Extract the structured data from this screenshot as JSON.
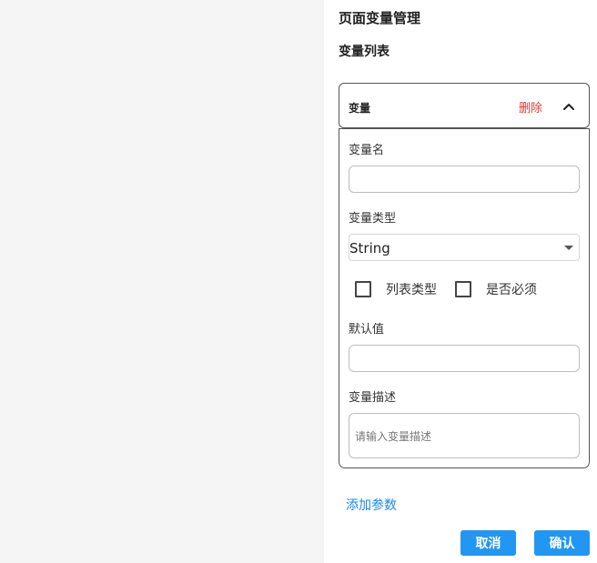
{
  "panel": {
    "title": "页面变量管理",
    "section_title": "变量列表"
  },
  "variable_card": {
    "header_label": "变量",
    "delete_label": "删除",
    "expanded": true,
    "fields": {
      "name_label": "变量名",
      "name_value": "",
      "type_label": "变量类型",
      "type_value": "String",
      "list_type_label": "列表类型",
      "list_type_checked": false,
      "required_label": "是否必须",
      "required_checked": false,
      "default_label": "默认值",
      "default_value": "",
      "desc_label": "变量描述",
      "desc_placeholder": "请输入变量描述"
    }
  },
  "actions": {
    "add_param_label": "添加参数",
    "cancel_label": "取消",
    "confirm_label": "确认"
  },
  "colors": {
    "accent": "#2196f3",
    "link": "#1e88e5",
    "danger": "#e53935",
    "backdrop": "#f5f5f5"
  }
}
